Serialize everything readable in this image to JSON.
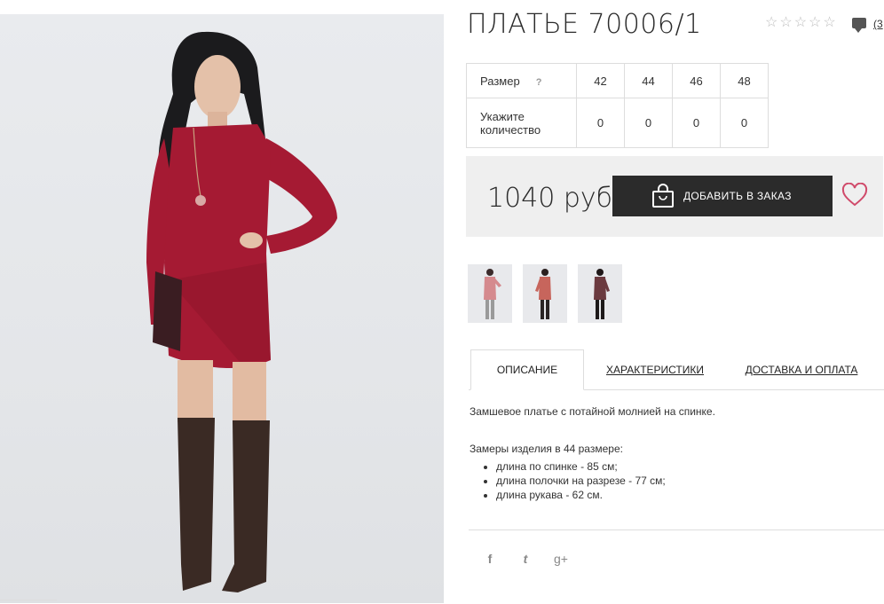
{
  "product": {
    "title": "ПЛАТЬЕ 70006/1",
    "comments_count": "(3",
    "price": "1040 руб",
    "add_button_label": "ДОБАВИТЬ В ЗАКАЗ",
    "rating": 0
  },
  "size_table": {
    "size_label": "Размер",
    "help": "?",
    "qty_label": "Укажите количество",
    "sizes": [
      "42",
      "44",
      "46",
      "48"
    ],
    "quantities": [
      "0",
      "0",
      "0",
      "0"
    ]
  },
  "tabs": [
    {
      "label": "ОПИСАНИЕ"
    },
    {
      "label": "ХАРАКТЕРИСТИКИ"
    },
    {
      "label": "ДОСТАВКА И ОПЛАТА"
    }
  ],
  "description": {
    "intro": "Замшевое платье с потайной молнией на спинке.",
    "measures_title": "Замеры изделия в 44 размере:",
    "measures": [
      "длина по спинке - 85 см;",
      "длина полочки на разрезе - 77 см;",
      "длина рукава - 62 см."
    ]
  },
  "social": {
    "facebook": "f",
    "twitter": "t",
    "gplus": "g+"
  },
  "colors": {
    "dress": "#a51a33",
    "button": "#2b2b2b",
    "heart": "#d04a6a"
  }
}
